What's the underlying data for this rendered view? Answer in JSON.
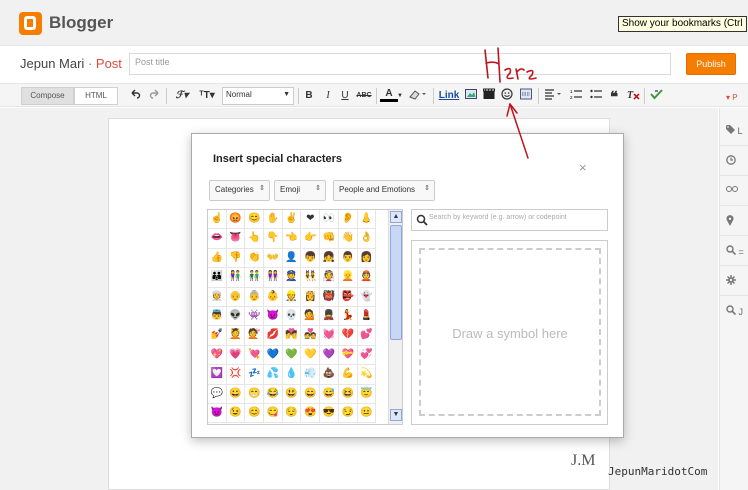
{
  "app": {
    "name": "Blogger",
    "tooltip": "Show your bookmarks (Ctrl"
  },
  "titlebar": {
    "blog_name": "Jepun Mari",
    "separator": "·",
    "section": "Post",
    "title_placeholder": "Post title",
    "publish_label": "Publish"
  },
  "toolbar": {
    "compose_label": "Compose",
    "html_label": "HTML",
    "font_value": "Normal",
    "bold": "B",
    "italic": "I",
    "underline": "U",
    "strike": "ABC",
    "text_color": "A",
    "link_label": "Link",
    "icons": [
      "undo-icon",
      "redo-icon",
      "font-icon",
      "font-size-icon",
      "highlight-icon",
      "image-icon",
      "video-icon",
      "emoji-icon",
      "jump-break-icon",
      "align-icon",
      "numbered-list-icon",
      "bullet-list-icon",
      "quote-icon",
      "clear-format-icon",
      "spellcheck-icon"
    ]
  },
  "sidebar": {
    "top_label": "P",
    "items": [
      {
        "icon": "label-icon",
        "text": "L"
      },
      {
        "icon": "schedule-icon",
        "text": ""
      },
      {
        "icon": "permalink-icon",
        "text": ""
      },
      {
        "icon": "location-icon",
        "text": ""
      },
      {
        "icon": "search-description-icon",
        "text": "="
      },
      {
        "icon": "options-icon",
        "text": ""
      },
      {
        "icon": "other-icon",
        "text": "J"
      }
    ]
  },
  "dialog": {
    "title": "Insert special characters",
    "close": "×",
    "dropdowns": {
      "category": "Categories",
      "type": "Emoji",
      "subset": "People and Emotions"
    },
    "search_placeholder": "Search by keyword (e.g. arrow) or codepoint",
    "draw_label": "Draw a symbol here",
    "grid_rows": [
      [
        "☝",
        "😡",
        "😊",
        "✋",
        "✌",
        "❤",
        "👀",
        "👂",
        "👃"
      ],
      [
        "👄",
        "👅",
        "👆",
        "👇",
        "👈",
        "👉",
        "👊",
        "👋",
        "👌"
      ],
      [
        "👍",
        "👎",
        "👏",
        "👐",
        "👤",
        "👦",
        "👧",
        "👨",
        "👩"
      ],
      [
        "👪",
        "👫",
        "👬",
        "👭",
        "👮",
        "👯",
        "👰",
        "👱",
        "👲"
      ],
      [
        "👳",
        "👴",
        "👵",
        "👶",
        "👷",
        "👸",
        "👹",
        "👺",
        "👻"
      ],
      [
        "👼",
        "👽",
        "👾",
        "👿",
        "💀",
        "💁",
        "💂",
        "💃",
        "💄"
      ],
      [
        "💅",
        "💆",
        "💇",
        "💋",
        "💏",
        "💑",
        "💓",
        "💔",
        "💕"
      ],
      [
        "💖",
        "💗",
        "💘",
        "💙",
        "💚",
        "💛",
        "💜",
        "💝",
        "💞"
      ],
      [
        "💟",
        "💢",
        "💤",
        "💦",
        "💧",
        "💨",
        "💩",
        "💪",
        "💫"
      ],
      [
        "💬",
        "😀",
        "😁",
        "😂",
        "😃",
        "😄",
        "😅",
        "😆",
        "😇"
      ],
      [
        "😈",
        "😉",
        "😊",
        "😋",
        "😌",
        "😍",
        "😎",
        "😏",
        "😐"
      ]
    ]
  },
  "annotation": {
    "text": "Here"
  },
  "watermark": {
    "monogram": "J.M",
    "text": "JepunMaridotCom"
  }
}
